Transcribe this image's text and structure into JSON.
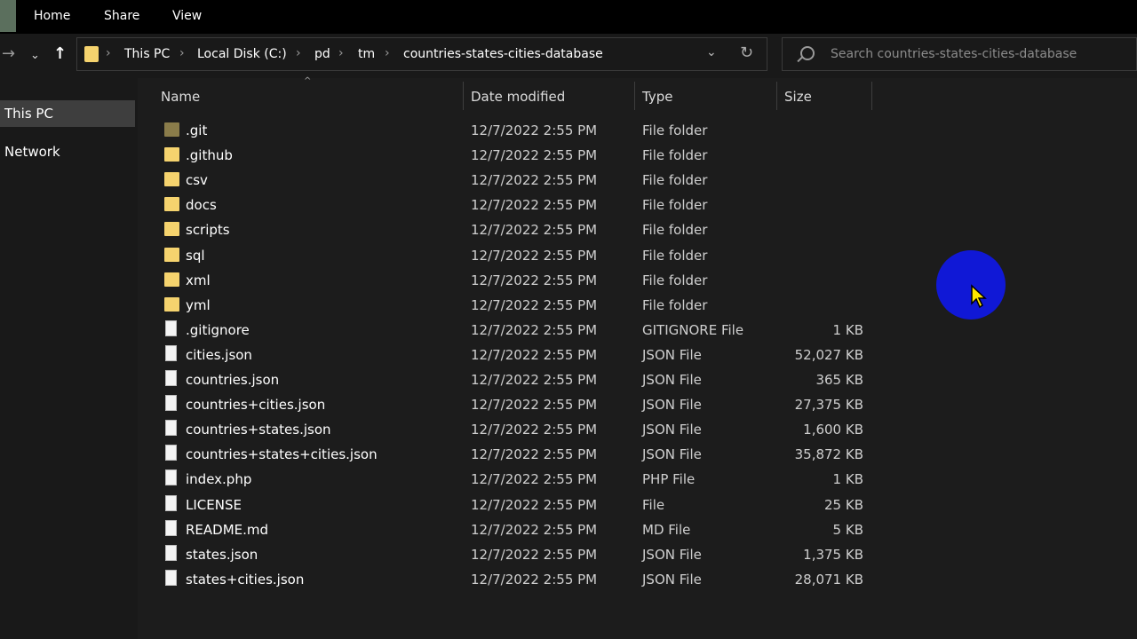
{
  "ribbon": {
    "tabs": [
      "Home",
      "Share",
      "View"
    ]
  },
  "address": {
    "crumbs": [
      "This PC",
      "Local Disk (C:)",
      "pd",
      "tm",
      "countries-states-cities-database"
    ]
  },
  "search": {
    "placeholder": "Search countries-states-cities-database"
  },
  "nav": {
    "items": [
      "This PC",
      "Network"
    ]
  },
  "columns": {
    "name": "Name",
    "date": "Date modified",
    "type": "Type",
    "size": "Size"
  },
  "files": [
    {
      "name": ".git",
      "date": "12/7/2022 2:55 PM",
      "type": "File folder",
      "size": "",
      "kind": "folder-git"
    },
    {
      "name": ".github",
      "date": "12/7/2022 2:55 PM",
      "type": "File folder",
      "size": "",
      "kind": "folder"
    },
    {
      "name": "csv",
      "date": "12/7/2022 2:55 PM",
      "type": "File folder",
      "size": "",
      "kind": "folder"
    },
    {
      "name": "docs",
      "date": "12/7/2022 2:55 PM",
      "type": "File folder",
      "size": "",
      "kind": "folder"
    },
    {
      "name": "scripts",
      "date": "12/7/2022 2:55 PM",
      "type": "File folder",
      "size": "",
      "kind": "folder"
    },
    {
      "name": "sql",
      "date": "12/7/2022 2:55 PM",
      "type": "File folder",
      "size": "",
      "kind": "folder"
    },
    {
      "name": "xml",
      "date": "12/7/2022 2:55 PM",
      "type": "File folder",
      "size": "",
      "kind": "folder"
    },
    {
      "name": "yml",
      "date": "12/7/2022 2:55 PM",
      "type": "File folder",
      "size": "",
      "kind": "folder"
    },
    {
      "name": ".gitignore",
      "date": "12/7/2022 2:55 PM",
      "type": "GITIGNORE File",
      "size": "1 KB",
      "kind": "file"
    },
    {
      "name": "cities.json",
      "date": "12/7/2022 2:55 PM",
      "type": "JSON File",
      "size": "52,027 KB",
      "kind": "file"
    },
    {
      "name": "countries.json",
      "date": "12/7/2022 2:55 PM",
      "type": "JSON File",
      "size": "365 KB",
      "kind": "file"
    },
    {
      "name": "countries+cities.json",
      "date": "12/7/2022 2:55 PM",
      "type": "JSON File",
      "size": "27,375 KB",
      "kind": "file"
    },
    {
      "name": "countries+states.json",
      "date": "12/7/2022 2:55 PM",
      "type": "JSON File",
      "size": "1,600 KB",
      "kind": "file"
    },
    {
      "name": "countries+states+cities.json",
      "date": "12/7/2022 2:55 PM",
      "type": "JSON File",
      "size": "35,872 KB",
      "kind": "file"
    },
    {
      "name": "index.php",
      "date": "12/7/2022 2:55 PM",
      "type": "PHP File",
      "size": "1 KB",
      "kind": "file"
    },
    {
      "name": "LICENSE",
      "date": "12/7/2022 2:55 PM",
      "type": "File",
      "size": "25 KB",
      "kind": "file"
    },
    {
      "name": "README.md",
      "date": "12/7/2022 2:55 PM",
      "type": "MD File",
      "size": "5 KB",
      "kind": "file"
    },
    {
      "name": "states.json",
      "date": "12/7/2022 2:55 PM",
      "type": "JSON File",
      "size": "1,375 KB",
      "kind": "file"
    },
    {
      "name": "states+cities.json",
      "date": "12/7/2022 2:55 PM",
      "type": "JSON File",
      "size": "28,071 KB",
      "kind": "file"
    }
  ],
  "colors": {
    "folder": "#f5d36e",
    "cursor_highlight": "#1018d6",
    "cursor": "#ffe600"
  }
}
